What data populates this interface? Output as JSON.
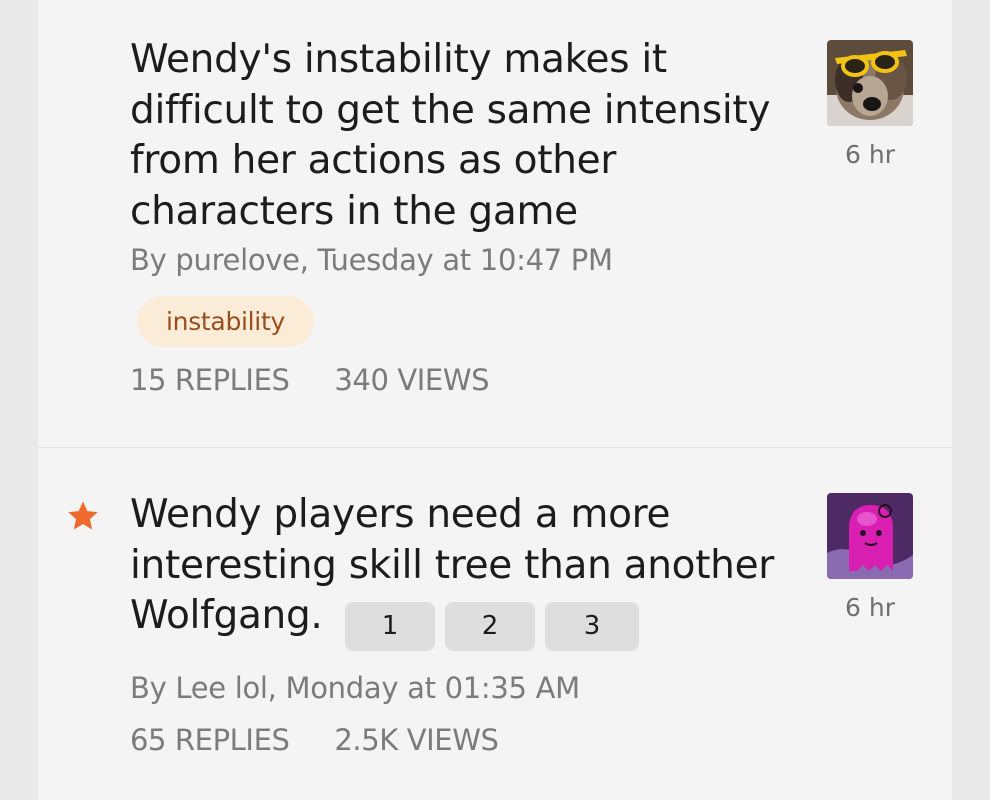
{
  "topics": [
    {
      "title": "Wendy's instability makes it difficult to get the same intensity from her actions as other characters in the game",
      "byline": "By purelove, Tuesday at 10:47 PM",
      "tag": "instability",
      "replies": "15 REPLIES",
      "views": "340 VIEWS",
      "time": "6 hr",
      "avatar_icon": "dog-with-sunglasses-avatar"
    },
    {
      "title": "Wendy players need a more interesting skill tree than another Wolfgang.",
      "byline": "By Lee lol, Monday at 01:35 AM",
      "replies": "65 REPLIES",
      "views": "2.5K VIEWS",
      "time": "6 hr",
      "pages": [
        "1",
        "2",
        "3"
      ],
      "starred_icon": "star-icon",
      "avatar_icon": "pink-ghost-avatar"
    }
  ],
  "colors": {
    "star": "#f06a2d",
    "tag_bg": "#fbecd7",
    "tag_text": "#9a4d1e"
  }
}
